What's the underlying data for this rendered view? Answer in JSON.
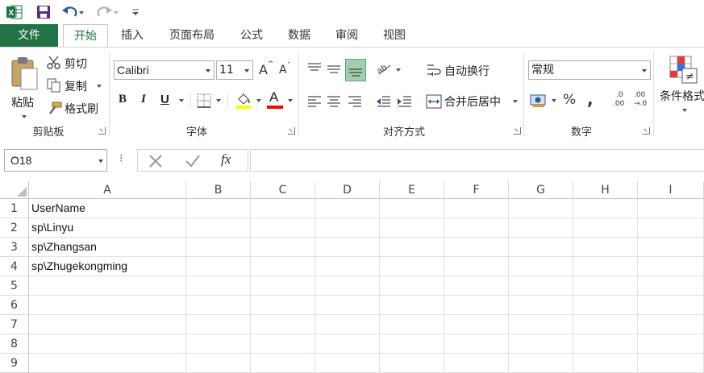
{
  "quick_access": {
    "app_icon": "excel-logo-icon",
    "save_icon": "save-icon",
    "undo_icon": "undo-icon",
    "redo_icon": "redo-icon",
    "customize_icon": "customize-qat-icon"
  },
  "tabs": [
    {
      "label": "文件"
    },
    {
      "label": "开始"
    },
    {
      "label": "插入"
    },
    {
      "label": "页面布局"
    },
    {
      "label": "公式"
    },
    {
      "label": "数据"
    },
    {
      "label": "审阅"
    },
    {
      "label": "视图"
    }
  ],
  "ribbon": {
    "clipboard": {
      "paste_label": "粘贴",
      "cut_label": "剪切",
      "copy_label": "复制",
      "format_painter_label": "格式刷",
      "group_label": "剪贴板"
    },
    "font": {
      "font_name": "Calibri",
      "font_size": "11",
      "bold": "B",
      "italic": "I",
      "underline": "U",
      "grow": "A",
      "shrink": "A",
      "font_color_letter": "A",
      "group_label": "字体",
      "highlight_color": "#ffff00",
      "font_color": "#ff0000"
    },
    "alignment": {
      "wrap_label": "自动换行",
      "merge_label": "合并后居中",
      "group_label": "对齐方式"
    },
    "number": {
      "format_value": "常规",
      "percent": "%",
      "comma": ",",
      "inc_decimal_top": ".0",
      "inc_decimal_bottom": ".00",
      "dec_decimal_top": ".00",
      "dec_decimal_bottom": "→.0",
      "group_label": "数字"
    },
    "styles": {
      "conditional_label": "条件格式"
    }
  },
  "formula_bar": {
    "name_box": "O18",
    "fx": "fx",
    "formula_value": ""
  },
  "sheet": {
    "columns": [
      "A",
      "B",
      "C",
      "D",
      "E",
      "F",
      "G",
      "H",
      "I"
    ],
    "rows": [
      {
        "num": "1",
        "a": "UserName"
      },
      {
        "num": "2",
        "a": "sp\\Linyu"
      },
      {
        "num": "3",
        "a": "sp\\Zhangsan"
      },
      {
        "num": "4",
        "a": "sp\\Zhugekongming"
      },
      {
        "num": "5",
        "a": ""
      },
      {
        "num": "6",
        "a": ""
      },
      {
        "num": "7",
        "a": ""
      },
      {
        "num": "8",
        "a": ""
      },
      {
        "num": "9",
        "a": ""
      }
    ]
  },
  "colors": {
    "excel_green": "#217346",
    "accent_green": "#9ed0b0"
  }
}
